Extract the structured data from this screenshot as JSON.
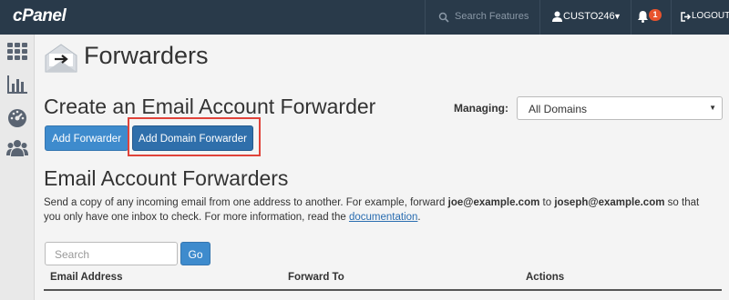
{
  "topbar": {
    "logo_text": "cPanel",
    "search_placeholder": "Search Features",
    "username": "CUSTO246",
    "notification_count": "1",
    "logout_label": "LOGOUT"
  },
  "sidebar": {
    "icons": [
      "grid-icon",
      "bar-chart-icon",
      "dashboard-gauge-icon",
      "users-icon"
    ]
  },
  "page": {
    "title": "Forwarders",
    "create_heading": "Create an Email Account Forwarder",
    "managing_label": "Managing:",
    "managing_value": "All Domains",
    "add_forwarder_label": "Add Forwarder",
    "add_domain_forwarder_label": "Add Domain Forwarder",
    "list_heading": "Email Account Forwarders",
    "description": {
      "part1": "Send a copy of any incoming email from one address to another. For example, forward ",
      "email1": "joe@example.com",
      "part2": " to ",
      "email2": "joseph@example.com",
      "part3": " so that you only have one inbox to check. For more information, read the ",
      "link": "documentation",
      "part4": "."
    },
    "search_placeholder": "Search",
    "go_label": "Go",
    "table_headers": [
      "Email Address",
      "Forward To",
      "Actions"
    ]
  },
  "colors": {
    "topbar_bg": "#293a4a",
    "primary_button": "#3e8bcd",
    "highlight": "#e0433a",
    "badge": "#e8542e",
    "link": "#2a6db0"
  }
}
